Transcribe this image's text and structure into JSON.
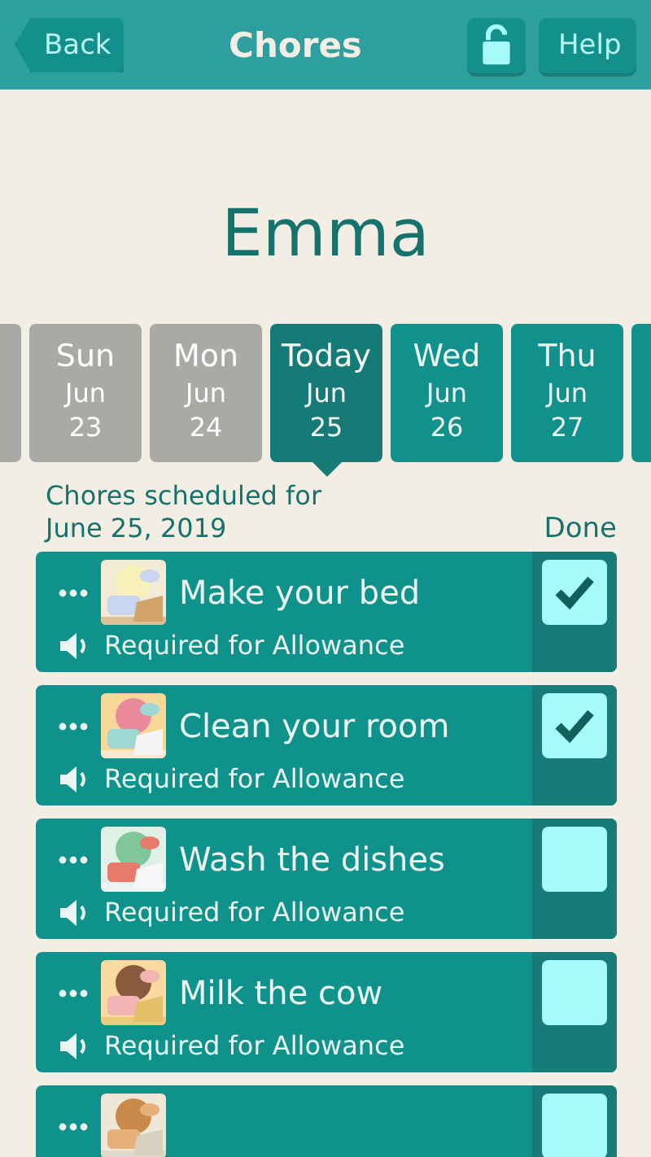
{
  "header": {
    "back": "Back",
    "title": "Chores",
    "locked": false,
    "help": "Help"
  },
  "child_name": "Emma",
  "days": [
    {
      "past": true,
      "selected": false
    },
    {
      "day": "Sun",
      "month": "Jun",
      "date": "23",
      "past": true,
      "selected": false
    },
    {
      "day": "Mon",
      "month": "Jun",
      "date": "24",
      "past": true,
      "selected": false
    },
    {
      "day": "Today",
      "month": "Jun",
      "date": "25",
      "past": false,
      "selected": true
    },
    {
      "day": "Wed",
      "month": "Jun",
      "date": "26",
      "past": false,
      "selected": false
    },
    {
      "day": "Thu",
      "month": "Jun",
      "date": "27",
      "past": false,
      "selected": false
    },
    {
      "past": false,
      "selected": false
    }
  ],
  "schedule_heading": "Chores scheduled for\nJune 25, 2019",
  "done_heading": "Done",
  "chores": [
    {
      "title": "Make your bed",
      "note": "Required for Allowance",
      "done": true
    },
    {
      "title": "Clean your room",
      "note": "Required for Allowance",
      "done": true
    },
    {
      "title": "Wash the dishes",
      "note": "Required for Allowance",
      "done": false
    },
    {
      "title": "Milk the cow",
      "note": "Required for Allowance",
      "done": false
    },
    {
      "done": false
    }
  ]
}
